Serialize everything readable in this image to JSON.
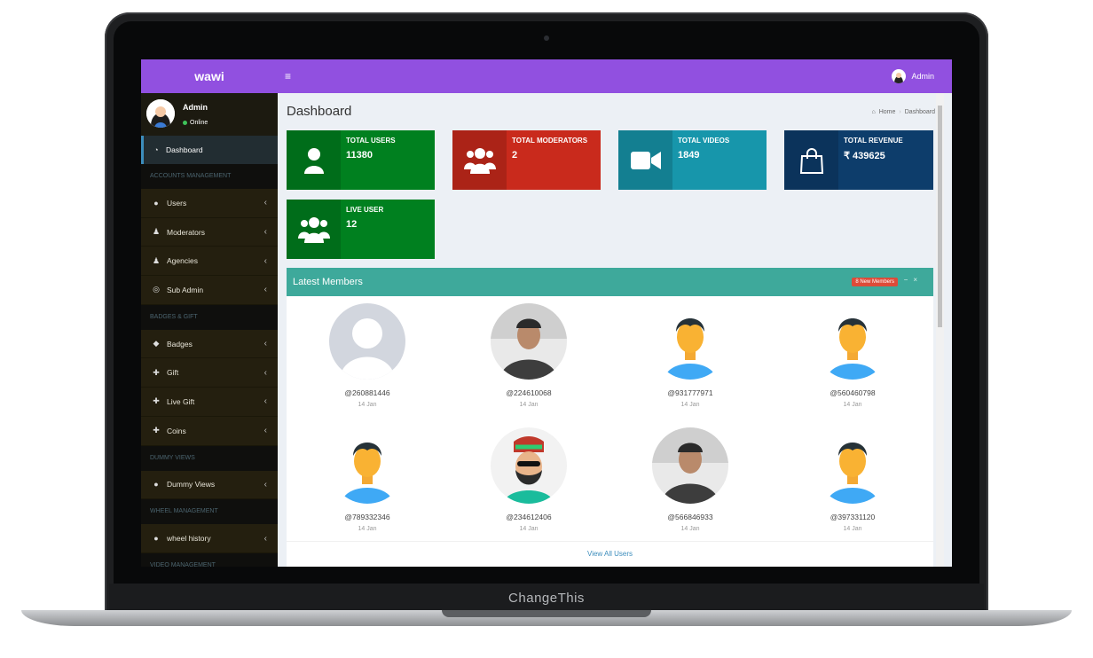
{
  "device": {
    "brand": "ChangeThis"
  },
  "topbar": {
    "logo": "wawi",
    "menu_icon": "≡",
    "user_name": "Admin",
    "accent": "#9150e0"
  },
  "sidebar": {
    "user": {
      "name": "Admin",
      "status": "Online"
    },
    "dashboard_label": "Dashboard",
    "sections": [
      {
        "header": "ACCOUNTS MANAGEMENT",
        "items": [
          {
            "icon": "user-icon",
            "label": "Users"
          },
          {
            "icon": "users-icon",
            "label": "Moderators"
          },
          {
            "icon": "users-icon",
            "label": "Agencies"
          },
          {
            "icon": "lifebuoy-icon",
            "label": "Sub Admin"
          }
        ]
      },
      {
        "header": "BADGES & GIFT",
        "items": [
          {
            "icon": "tag-icon",
            "label": "Badges"
          },
          {
            "icon": "gift-icon",
            "label": "Gift"
          },
          {
            "icon": "gift-icon",
            "label": "Live Gift"
          },
          {
            "icon": "gift-icon",
            "label": "Coins"
          }
        ]
      },
      {
        "header": "Dummy Views",
        "items": [
          {
            "icon": "circle-icon",
            "label": "Dummy Views"
          }
        ]
      },
      {
        "header": "WHEEL MANAGEMENT",
        "items": [
          {
            "icon": "circle-icon",
            "label": "wheel history"
          }
        ]
      },
      {
        "header": "VIDEO MANAGEMENT",
        "items": []
      }
    ]
  },
  "page": {
    "title": "Dashboard",
    "breadcrumb": [
      "Home",
      "Dashboard"
    ]
  },
  "stats": [
    {
      "label": "TOTAL USERS",
      "value": "11380",
      "color": "#00801f",
      "icon": "user-icon"
    },
    {
      "label": "TOTAL MODERATORS",
      "value": "2",
      "color": "#c92a1c",
      "icon": "users-icon"
    },
    {
      "label": "TOTAL VIDEOS",
      "value": "1849",
      "color": "#1796ab",
      "icon": "video-camera-icon"
    },
    {
      "label": "TOTAL REVENUE",
      "value": "₹ 439625",
      "color": "#0d3d6b",
      "icon": "shopping-bag-icon"
    },
    {
      "label": "LIVE USER",
      "value": "12",
      "color": "#00801f",
      "icon": "users-icon"
    }
  ],
  "members_panel": {
    "title": "Latest Members",
    "badge": "8 New Members",
    "footer_link": "View All Users",
    "members": [
      {
        "handle": "@260881446",
        "date": "14 Jan",
        "avatar": "default-silhouette"
      },
      {
        "handle": "@224610068",
        "date": "14 Jan",
        "avatar": "photo"
      },
      {
        "handle": "@931777971",
        "date": "14 Jan",
        "avatar": "cartoon-man"
      },
      {
        "handle": "@560460798",
        "date": "14 Jan",
        "avatar": "cartoon-man"
      },
      {
        "handle": "@789332346",
        "date": "14 Jan",
        "avatar": "cartoon-man"
      },
      {
        "handle": "@234612406",
        "date": "14 Jan",
        "avatar": "illustration"
      },
      {
        "handle": "@566846933",
        "date": "14 Jan",
        "avatar": "photo"
      },
      {
        "handle": "@397331120",
        "date": "14 Jan",
        "avatar": "cartoon-man"
      }
    ]
  }
}
